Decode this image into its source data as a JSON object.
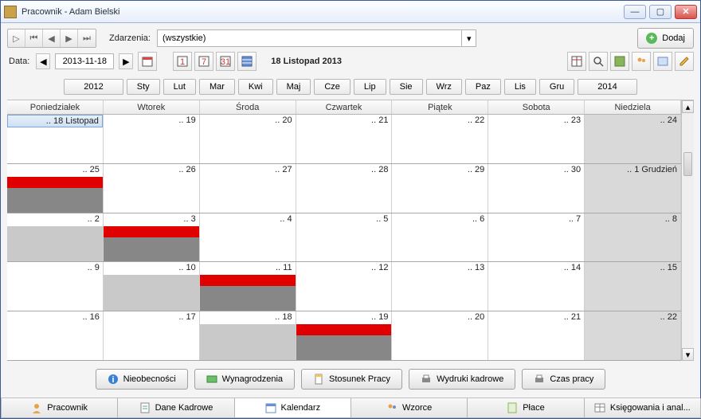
{
  "window": {
    "title": "Pracownik - Adam Bielski"
  },
  "toolbar": {
    "events_label": "Zdarzenia:",
    "events_value": "(wszystkie)",
    "add_label": "Dodaj"
  },
  "daterow": {
    "date_label": "Data:",
    "date_value": "2013-11-18",
    "header": "18 Listopad 2013"
  },
  "navbar": {
    "prev_year": "2012",
    "next_year": "2014",
    "months": [
      "Sty",
      "Lut",
      "Mar",
      "Kwi",
      "Maj",
      "Cze",
      "Lip",
      "Sie",
      "Wrz",
      "Paz",
      "Lis",
      "Gru"
    ]
  },
  "calendar": {
    "weekdays": [
      "Poniedziałek",
      "Wtorek",
      "Środa",
      "Czwartek",
      "Piątek",
      "Sobota",
      "Niedziela"
    ],
    "rows": [
      [
        {
          "label": ".. 18 Listopad",
          "sel": true
        },
        {
          "label": ".. 19"
        },
        {
          "label": ".. 20"
        },
        {
          "label": ".. 21"
        },
        {
          "label": ".. 22"
        },
        {
          "label": ".. 23"
        },
        {
          "label": ".. 24",
          "wk": true
        }
      ],
      [
        {
          "label": ".. 25",
          "red": true,
          "gray": true
        },
        {
          "label": ".. 26"
        },
        {
          "label": ".. 27"
        },
        {
          "label": ".. 28"
        },
        {
          "label": ".. 29"
        },
        {
          "label": ".. 30"
        },
        {
          "label": ".. 1 Grudzień",
          "wk": true
        }
      ],
      [
        {
          "label": ".. 2",
          "light": true
        },
        {
          "label": ".. 3",
          "red": true,
          "gray": true
        },
        {
          "label": ".. 4"
        },
        {
          "label": ".. 5"
        },
        {
          "label": ".. 6"
        },
        {
          "label": ".. 7"
        },
        {
          "label": ".. 8",
          "wk": true
        }
      ],
      [
        {
          "label": ".. 9"
        },
        {
          "label": ".. 10",
          "light": true
        },
        {
          "label": ".. 11",
          "red": true,
          "gray": true
        },
        {
          "label": ".. 12"
        },
        {
          "label": ".. 13"
        },
        {
          "label": ".. 14"
        },
        {
          "label": ".. 15",
          "wk": true
        }
      ],
      [
        {
          "label": ".. 16"
        },
        {
          "label": ".. 17"
        },
        {
          "label": ".. 18",
          "light": true
        },
        {
          "label": ".. 19",
          "red": true,
          "gray": true
        },
        {
          "label": ".. 20"
        },
        {
          "label": ".. 21"
        },
        {
          "label": ".. 22",
          "wk": true
        }
      ]
    ]
  },
  "actions": {
    "a1": "Nieobecności",
    "a2": "Wynagrodzenia",
    "a3": "Stosunek Pracy",
    "a4": "Wydruki kadrowe",
    "a5": "Czas pracy"
  },
  "tabs": {
    "t1": "Pracownik",
    "t2": "Dane Kadrowe",
    "t3": "Kalendarz",
    "t4": "Wzorce",
    "t5": "Płace",
    "t6": "Księgowania i anal..."
  }
}
